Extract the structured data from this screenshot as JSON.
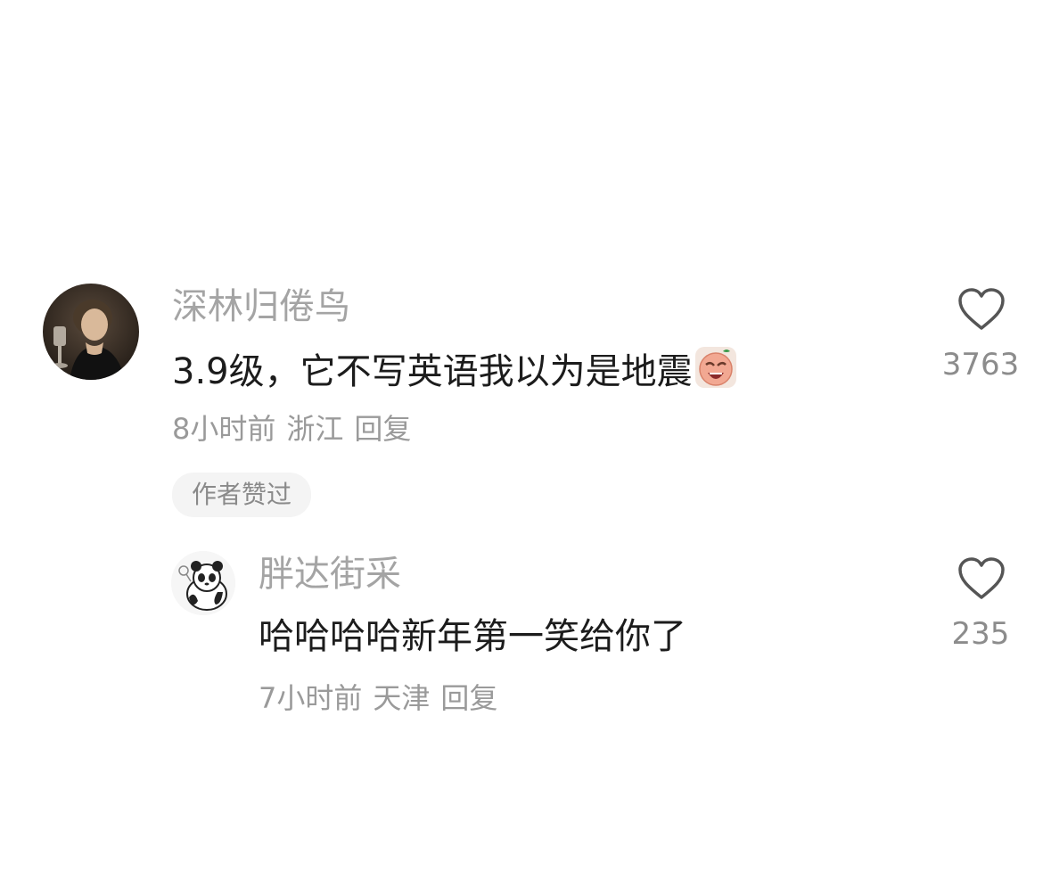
{
  "comments": [
    {
      "username": "深林归倦鸟",
      "text": "3.9级，它不写英语我以为是地震",
      "emoji": "crying-face-icon",
      "time": "8小时前",
      "location": "浙江",
      "reply_label": "回复",
      "likes": "3763",
      "badge": "作者赞过",
      "replies": [
        {
          "username": "胖达街采",
          "text": "哈哈哈哈新年第一笑给你了",
          "time": "7小时前",
          "location": "天津",
          "reply_label": "回复",
          "likes": "235"
        }
      ]
    }
  ],
  "colors": {
    "username": "#a4a4a4",
    "text": "#1c1c1c",
    "meta": "#9a9a9a",
    "badge_bg": "#f4f4f4",
    "like_icon": "#555555"
  }
}
